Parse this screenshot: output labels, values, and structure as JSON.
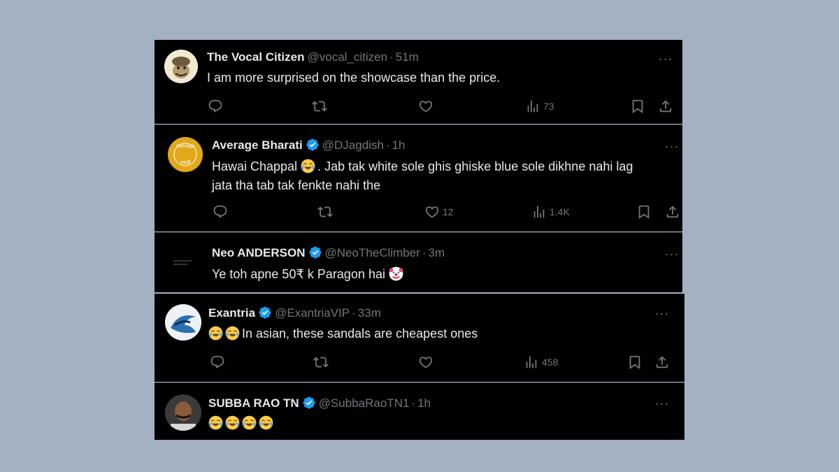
{
  "tweets": [
    {
      "name": "The Vocal Citizen",
      "handle": "@vocal_citizen",
      "time": "51m",
      "text": "I am more surprised on the showcase than the price.",
      "views": "73",
      "likes": "",
      "verified": false
    },
    {
      "name": "Average Bharati",
      "handle": "@DJagdish",
      "time": "1h",
      "text_before_emoji": "Hawai Chappal",
      "emoji_1": "face-with-tears-of-joy",
      "text_after_emoji": ". Jab tak white sole ghis ghiske blue sole dikhne nahi lag",
      "text_line_2": "jata tha tab tak fenkte nahi the",
      "likes": "12",
      "views": "1.4K",
      "verified": true,
      "avatar_text_top": "Average",
      "avatar_text_bottom": "भारती"
    },
    {
      "name": "Neo ANDERSON",
      "handle": "@NeoTheClimber",
      "time": "3m",
      "text": "Ye toh apne 50₹ k Paragon hai",
      "emoji": "clown-face",
      "verified": true
    },
    {
      "name": "Exantria",
      "handle": "@ExantriaVIP",
      "time": "33m",
      "emojis": [
        "face-with-tears-of-joy",
        "face-with-tears-of-joy"
      ],
      "text": "In asian, these sandals are cheapest ones",
      "views": "458",
      "likes": "",
      "verified": true
    },
    {
      "name": "SUBBA RAO TN",
      "handle": "@SubbaRaoTN1",
      "time": "1h",
      "emojis": [
        "face-with-tears-of-joy",
        "face-with-tears-of-joy",
        "face-with-tears-of-joy",
        "face-with-tears-of-joy"
      ],
      "verified": true
    }
  ],
  "ui": {
    "dot": "·",
    "more": "···"
  },
  "colors": {
    "background": "#a3b1c2",
    "card": "#000000",
    "text": "#e7e9ea",
    "muted": "#71767b",
    "verified": "#1d9bf0"
  }
}
